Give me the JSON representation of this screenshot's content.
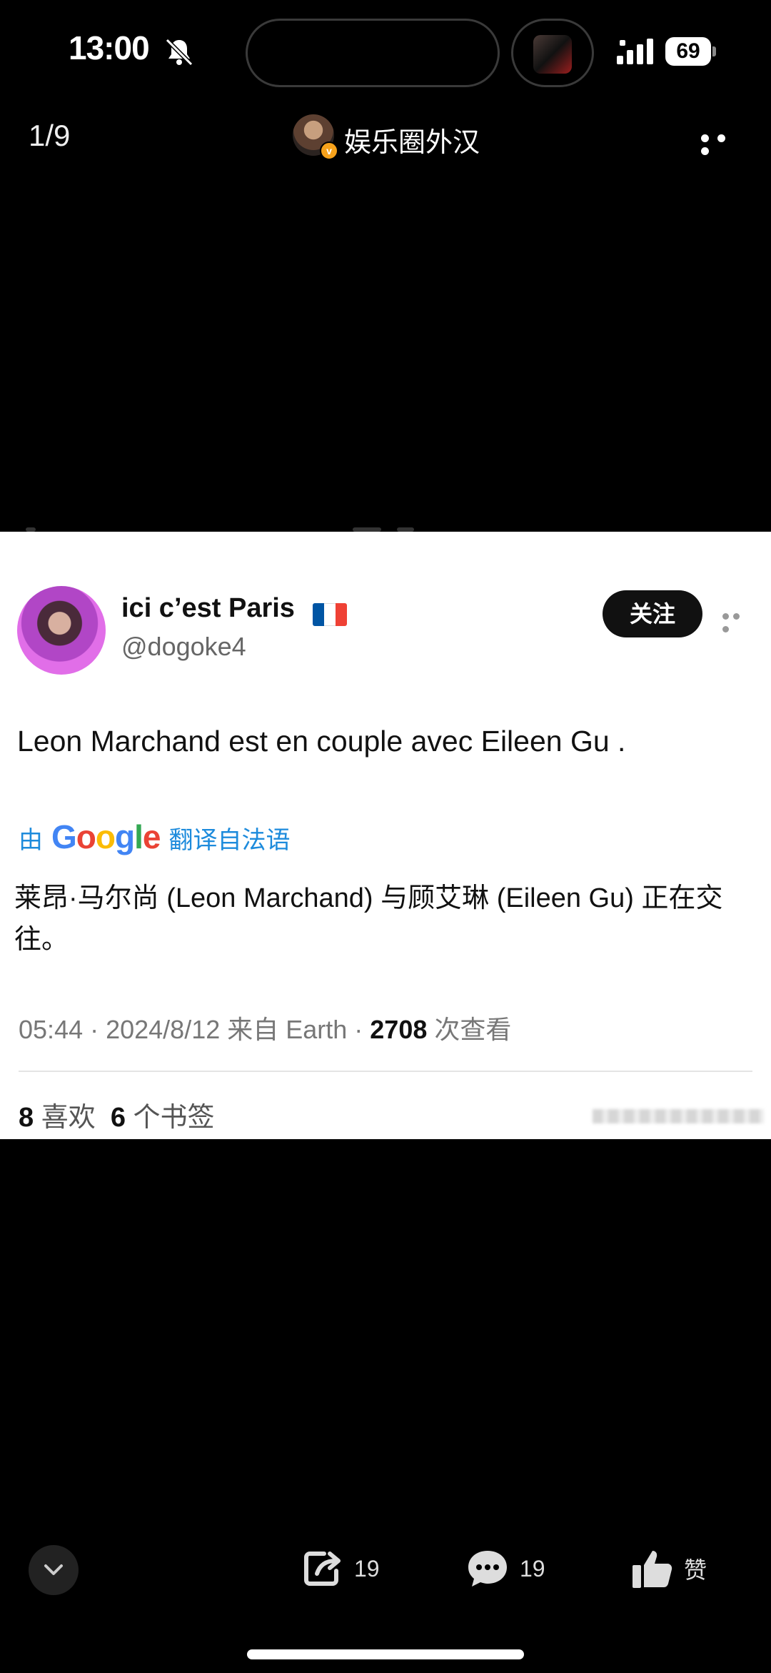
{
  "status_bar": {
    "time": "13:00",
    "battery": "69"
  },
  "nav": {
    "counter": "1/9",
    "author": "娱乐圈外汉",
    "verified_badge": "v"
  },
  "card": {
    "display_name": "ici c’est Paris",
    "flag_colors": [
      "#0055A4",
      "#FFFFFF",
      "#EF4135"
    ],
    "handle": "@dogoke4",
    "follow_label": "关注",
    "tweet_text": "Leon Marchand est en couple avec Eileen Gu .",
    "translate_prefix": "由",
    "translate_brand": "Google",
    "translate_suffix": "翻译自法语",
    "translation": "莱昂·马尔尚 (Leon Marchand) 与顾艾琳 (Eileen Gu) 正在交往。",
    "meta_time": "05:44 · 2024/8/12 来自 Earth · ",
    "meta_views": "2708",
    "meta_views_label": " 次查看",
    "likes_count": "8",
    "likes_label": " 喜欢  ",
    "bookmarks_count": "6",
    "bookmarks_label": " 个书签"
  },
  "bottom_bar": {
    "share_count": "19",
    "comment_count": "19",
    "like_label": "赞"
  }
}
